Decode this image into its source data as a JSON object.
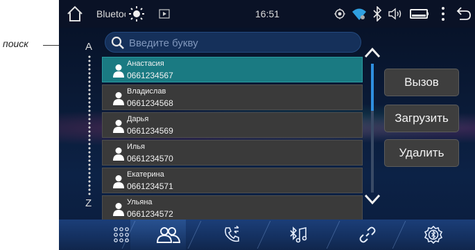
{
  "callout": {
    "label": "поиск"
  },
  "statusbar": {
    "app_title": "Bluetooth",
    "time": "16:51",
    "icons": [
      "home-icon",
      "brightness-icon",
      "video-icon",
      "gps-icon",
      "wifi-icon",
      "bluetooth-icon",
      "volume-icon",
      "battery-icon",
      "more-vert-icon",
      "back-icon"
    ]
  },
  "search": {
    "placeholder": "Введите букву",
    "value": ""
  },
  "alphabet": {
    "first": "A",
    "last": "Z"
  },
  "contacts": [
    {
      "name": "Анастасия",
      "phone": "0661234567",
      "selected": true
    },
    {
      "name": "Владислав",
      "phone": "0661234568",
      "selected": false
    },
    {
      "name": "Дарья",
      "phone": "0661234569",
      "selected": false
    },
    {
      "name": "Илья",
      "phone": "0661234570",
      "selected": false
    },
    {
      "name": "Екатерина",
      "phone": "0661234571",
      "selected": false
    },
    {
      "name": "Ульяна",
      "phone": "0661234572",
      "selected": false
    }
  ],
  "actions": {
    "call": "Вызов",
    "load": "Загрузить",
    "delete": "Удалить"
  },
  "dock": {
    "items": [
      "dialpad-icon",
      "contacts-icon",
      "call-log-icon",
      "bt-music-icon",
      "link-icon",
      "bt-settings-icon"
    ],
    "active": "contacts-icon"
  },
  "colors": {
    "selected": "#1a7a82",
    "accent": "#2f8fe0",
    "dock": "#1b3e78"
  }
}
